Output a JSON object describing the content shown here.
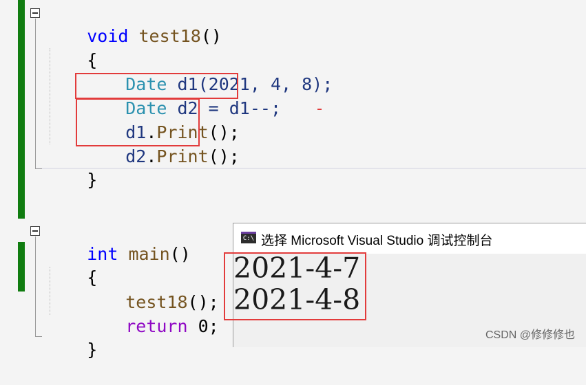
{
  "editor": {
    "test18": {
      "kw_void": "void",
      "name": "test18",
      "parens": "()",
      "open_brace": "{",
      "l1_type": "Date",
      "l1_rest": "d1(2021, 4, 8);",
      "l2_type": "Date",
      "l2_rest": "d2 = d1--;",
      "l3_var": "d1",
      "l3_dot": ".",
      "l3_fn": "Print",
      "l3_end": "();",
      "l4_var": "d2",
      "l4_dot": ".",
      "l4_fn": "Print",
      "l4_end": "();",
      "close_brace": "}"
    },
    "main": {
      "kw_int": "int",
      "name": "main",
      "parens": "()",
      "open_brace": "{",
      "call_fn": "test18",
      "call_end": "();",
      "kw_return": "return",
      "return_rest": " 0;",
      "close_brace": "}"
    }
  },
  "console": {
    "icon_text": "C:\\",
    "title": "选择 Microsoft Visual Studio 调试控制台",
    "output": [
      "2021-4-7",
      "2021-4-8"
    ]
  },
  "watermark": "CSDN @修修修也",
  "colors": {
    "keyword": "#0000ff",
    "keyword_return": "#8f08c4",
    "type": "#2b91af",
    "function": "#74531f",
    "variable": "#1f377f",
    "highlight_box": "#e23b3b",
    "change_bar": "#107c10"
  }
}
